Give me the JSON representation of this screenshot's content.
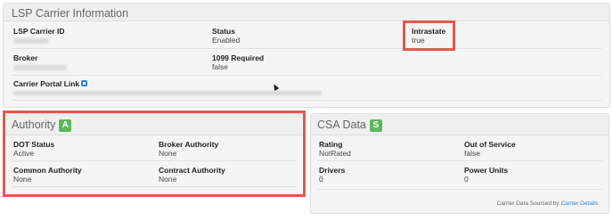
{
  "lsp": {
    "title": "LSP Carrier Information",
    "carrier_id_label": "LSP Carrier ID",
    "status_label": "Status",
    "status_value": "Enabled",
    "intrastate_label": "Intrastate",
    "intrastate_value": "true",
    "broker_label": "Broker",
    "required_1099_label": "1099 Required",
    "required_1099_value": "false",
    "portal_label": "Carrier Portal Link"
  },
  "authority": {
    "title": "Authority",
    "badge": "A",
    "dot_status_label": "DOT Status",
    "dot_status_value": "Active",
    "broker_authority_label": "Broker Authority",
    "broker_authority_value": "None",
    "common_authority_label": "Common Authority",
    "common_authority_value": "None",
    "contract_authority_label": "Contract Authority",
    "contract_authority_value": "None"
  },
  "csa": {
    "title": "CSA Data",
    "badge": "S",
    "rating_label": "Rating",
    "rating_value": "NotRated",
    "out_of_service_label": "Out of Service",
    "out_of_service_value": "false",
    "drivers_label": "Drivers",
    "drivers_value": "0",
    "power_units_label": "Power Units",
    "power_units_value": "0"
  },
  "footer": {
    "text": "Carrier Data Sourced by",
    "link": "Carrier Details"
  },
  "colors": {
    "highlight": "#e05a4e",
    "badge": "#5cb85c",
    "link": "#2a7fd4"
  }
}
